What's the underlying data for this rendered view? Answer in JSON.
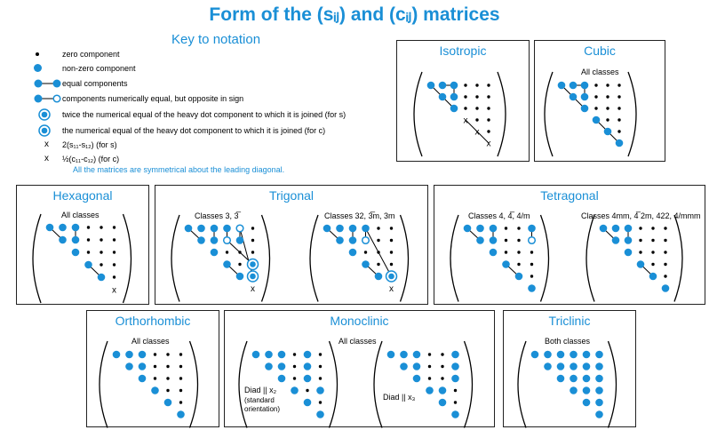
{
  "title": "Form of the (sᵢⱼ) and (cᵢⱼ) matrices",
  "key": {
    "heading": "Key to notation",
    "items": [
      "zero component",
      "non-zero component",
      "equal components",
      "components numerically equal, but opposite in sign",
      "twice the numerical equal of the heavy dot component to which it is joined (for s)",
      "the numerical equal of the heavy dot component to which it is joined (for c)",
      "2(s₁₁-s₁₂)  (for s)",
      "½(c₁₁-c₁₂)  (for c)"
    ],
    "x_symbol": "x",
    "note": "All the matrices are symmetrical about the leading diagonal."
  },
  "panels": {
    "isotropic": {
      "title": "Isotropic"
    },
    "cubic": {
      "title": "Cubic",
      "sub": "All classes"
    },
    "hexagonal": {
      "title": "Hexagonal",
      "sub": "All classes"
    },
    "trigonal": {
      "title": "Trigonal",
      "sub1": "Classes 3, 3̅",
      "sub2": "Classes 32, 3̅m, 3m"
    },
    "tetragonal": {
      "title": "Tetragonal",
      "sub1": "Classes 4, 4̅, 4/m",
      "sub2": "Classes 4mm, 4̅ 2m, 422, 4/mmm"
    },
    "orthorhombic": {
      "title": "Orthorhombic",
      "sub": "All classes"
    },
    "monoclinic": {
      "title": "Monoclinic",
      "sub": "All classes",
      "diad1_line1": "Diad || x₂",
      "diad1_line2": "(standard",
      "diad1_line3": "orientation)",
      "diad2": "Diad || x₃"
    },
    "triclinic": {
      "title": "Triclinic",
      "sub": "Both classes"
    }
  },
  "colors": {
    "accent": "#1a8fd6",
    "ink": "#000000"
  }
}
